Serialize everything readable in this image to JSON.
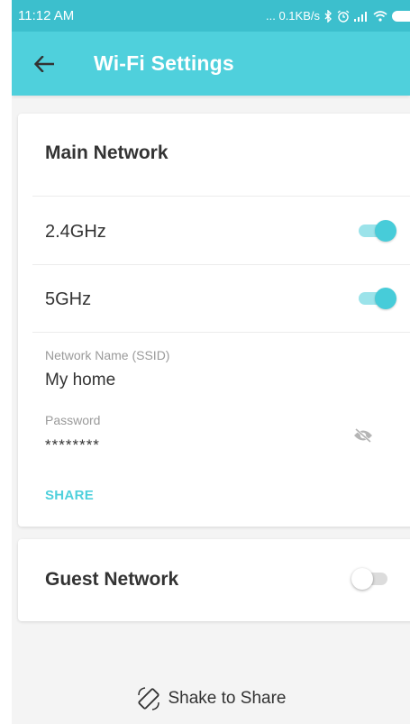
{
  "status_bar": {
    "time": "11:12 AM",
    "network_speed": "... 0.1KB/s",
    "icons": [
      "bluetooth-icon",
      "alarm-icon",
      "signal-icon",
      "wifi-icon",
      "battery-icon"
    ]
  },
  "app_bar": {
    "title": "Wi-Fi Settings",
    "back_icon": "arrow-back-icon"
  },
  "main_network": {
    "title": "Main Network",
    "band_24": {
      "label": "2.4GHz",
      "enabled": true
    },
    "band_5": {
      "label": "5GHz",
      "enabled": true
    },
    "ssid": {
      "label": "Network Name (SSID)",
      "value": "My home"
    },
    "password": {
      "label": "Password",
      "value": "********",
      "visibility_icon": "eye-off-icon"
    },
    "share_label": "SHARE"
  },
  "guest_network": {
    "title": "Guest Network",
    "enabled": false
  },
  "shake_to_share": {
    "label": "Shake to Share",
    "icon": "rotate-phone-icon"
  },
  "colors": {
    "accent": "#4fd0dc",
    "status_bar": "#3cbfcd",
    "toggle_on": "#47ccd9",
    "toggle_track_on": "#9be3ea",
    "toggle_off_track": "#dcdcdc",
    "text": "#333333",
    "muted_text": "#9a9a9a"
  }
}
